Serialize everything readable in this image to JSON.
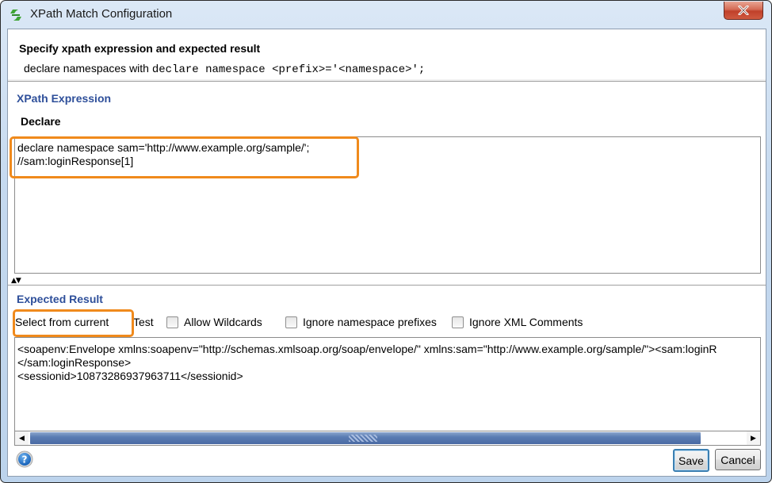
{
  "window": {
    "title": "XPath Match Configuration",
    "app_icon": "soapui-logo-icon",
    "close_icon": "close-icon"
  },
  "header": {
    "title": "Specify xpath expression and expected result",
    "subtitle_prefix": "declare namespaces with ",
    "subtitle_code": "declare namespace <prefix>='<namespace>';"
  },
  "xpath_section": {
    "label": "XPath Expression",
    "declare_button": "Declare",
    "expression_lines": [
      "declare namespace sam='http://www.example.org/sample/';",
      "//sam:loginResponse[1]"
    ]
  },
  "splitter": {
    "up_icon": "▲",
    "down_icon": "▼"
  },
  "expected_section": {
    "label": "Expected Result",
    "select_from_current": "Select from current",
    "test_button": "Test",
    "checkboxes": [
      {
        "label": "Allow Wildcards",
        "checked": false
      },
      {
        "label": "Ignore namespace prefixes",
        "checked": false
      },
      {
        "label": "Ignore XML Comments",
        "checked": false
      }
    ],
    "result_lines": [
      "<soapenv:Envelope xmlns:soapenv=\"http://schemas.xmlsoap.org/soap/envelope/\" xmlns:sam=\"http://www.example.org/sample/\"><sam:loginR",
      "</sam:loginResponse>",
      "<sessionid>10873286937963711</sessionid>"
    ]
  },
  "scrollbar": {
    "left_arrow": "◀",
    "right_arrow": "▶"
  },
  "footer": {
    "help_icon": "help-icon",
    "save": "Save",
    "cancel": "Cancel"
  },
  "colors": {
    "highlight": "#f08a1c",
    "section_label": "#2e4f9a",
    "scroll_thumb": "#5a7cb3"
  }
}
